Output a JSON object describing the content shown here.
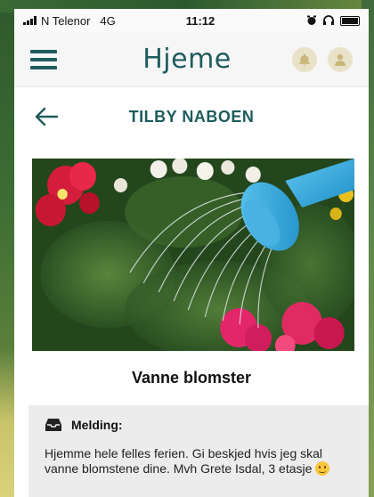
{
  "status_bar": {
    "carrier": "N Telenor",
    "network": "4G",
    "time": "11:12"
  },
  "header": {
    "logo": "Hjeme"
  },
  "page": {
    "title": "TILBY NABOEN"
  },
  "item": {
    "title": "Vanne blomster"
  },
  "message": {
    "label": "Melding:",
    "body": "Hjemme hele felles ferien. Gi beskjed hvis jeg skal vanne blomstene dine. Mvh Grete Isdal, 3 etasje"
  },
  "colors": {
    "brand": "#1e5c5c",
    "card": "#ececec",
    "header_bg": "#f6f6f6",
    "icon_bg": "#e9e2c9"
  },
  "icons": {
    "menu": "hamburger-icon",
    "bell": "bell-icon",
    "user": "user-icon",
    "back": "back-arrow-icon",
    "inbox": "inbox-icon",
    "emoji": "smile-emoji-icon"
  }
}
